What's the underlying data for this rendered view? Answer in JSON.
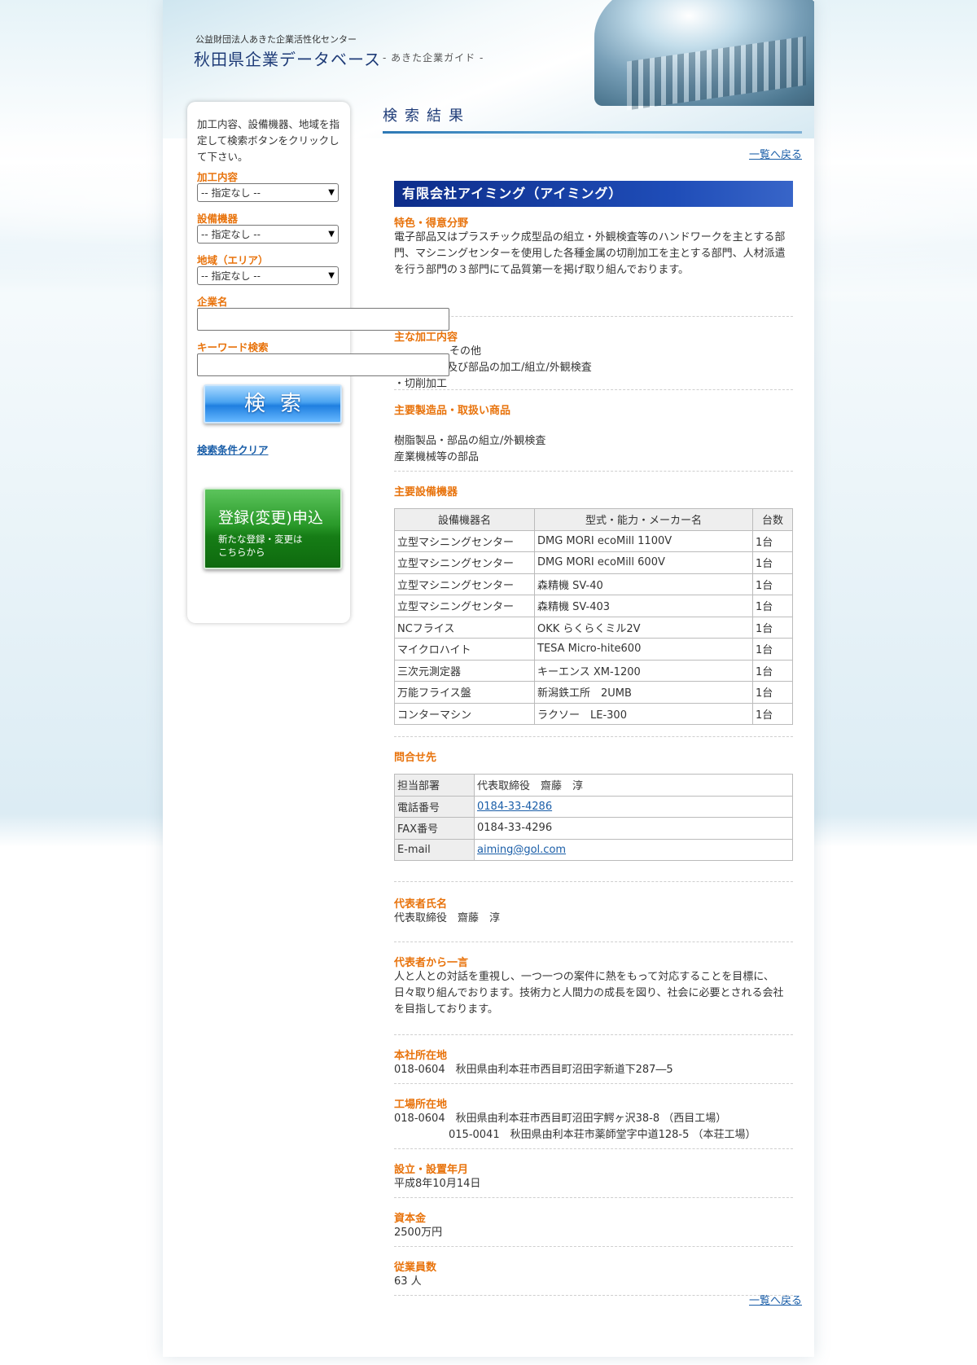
{
  "header": {
    "org_name": "公益財団法人あきた企業活性化センター",
    "site_title": "秋田県企業データベース",
    "site_sub": "- あきた企業ガイド -"
  },
  "sidebar": {
    "intro": "加工内容、設備機器、地域を指定して検索ボタンをクリックして下さい。",
    "fields": [
      {
        "label": "加工内容",
        "value": "-- 指定なし --"
      },
      {
        "label": "設備機器",
        "value": "-- 指定なし --"
      },
      {
        "label": "地域（エリア）",
        "value": "-- 指定なし --"
      }
    ],
    "company_label": "企業名",
    "keyword_label": "キーワード検索",
    "search_button": "検索",
    "clear_link": "検索条件クリア",
    "register_big": "登録(変更)申込",
    "register_small_1": "新たな登録・変更は",
    "register_small_2": "こちらから"
  },
  "main": {
    "title": "検索結果",
    "back_link": "一覧へ戻る",
    "company_name": "有限会社アイミング（アイミング）",
    "features_label": "特色・得意分野",
    "features_text": "電子部品又はプラスチック成型品の組立・外観検査等のハンドワークを主とする部門、マシニングセンターを使用した各種金属の切削加工を主とする部門、人材派遣を行う部門の３部門にて品質第一を掲げ取り組んでおります。",
    "processing_label": "主な加工内容",
    "processing_items": [
      "その他",
      "・樹脂製品及び部品の加工/組立/外観検査",
      "・切削加工"
    ],
    "products_label": "主要製造品・取扱い商品",
    "products_items": [
      "樹脂製品・部品の組立/外観検査",
      "産業機械等の部品"
    ],
    "equipment_label": "主要設備機器",
    "equipment_headers": [
      "設備機器名",
      "型式・能力・メーカー名",
      "台数"
    ],
    "equipment_rows": [
      [
        "立型マシニングセンター",
        "DMG MORI ecoMill 1100V",
        "1台"
      ],
      [
        "立型マシニングセンター",
        "DMG MORI ecoMill 600V",
        "1台"
      ],
      [
        "立型マシニングセンター",
        "森精機 SV-40",
        "1台"
      ],
      [
        "立型マシニングセンター",
        "森精機 SV-403",
        "1台"
      ],
      [
        "NCフライス",
        "OKK らくらくミル2V",
        "1台"
      ],
      [
        "マイクロハイト",
        "TESA Micro-hite600",
        "1台"
      ],
      [
        "三次元測定器",
        "キーエンス XM-1200",
        "1台"
      ],
      [
        "万能フライス盤",
        "新潟鉄工所　2UMB",
        "1台"
      ],
      [
        "コンターマシン",
        "ラクソー　LE-300",
        "1台"
      ]
    ],
    "contact_label": "問合せ先",
    "contact": {
      "dept_label": "担当部署",
      "dept": "代表取締役　齋藤　淳",
      "tel_label": "電話番号",
      "tel": "0184-33-4286",
      "fax_label": "FAX番号",
      "fax": "0184-33-4296",
      "email_label": "E-mail",
      "email": "aiming@gol.com"
    },
    "rep_label": "代表者氏名",
    "rep_name": "代表取締役　齋藤　淳",
    "message_label": "代表者から一言",
    "message_text": "人と人との対話を重視し、一つ一つの案件に熱をもって対応することを目標に、日々取り組んでおります。技術力と人間力の成長を図り、社会に必要とされる会社を目指しております。",
    "hq_label": "本社所在地",
    "hq": "018-0604　秋田県由利本荘市西目町沼田字新道下287―5",
    "factory_label": "工場所在地",
    "factory_1": "018-0604　秋田県由利本荘市西目町沼田字鰐ヶ沢38-8 （西目工場）",
    "factory_2": "015-0041　秋田県由利本荘市薬師堂字中道128-5 （本荘工場）",
    "founded_label": "設立・設置年月",
    "founded": "平成8年10月14日",
    "capital_label": "資本金",
    "capital": "2500万円",
    "employees_label": "従業員数",
    "employees": "63 人"
  }
}
